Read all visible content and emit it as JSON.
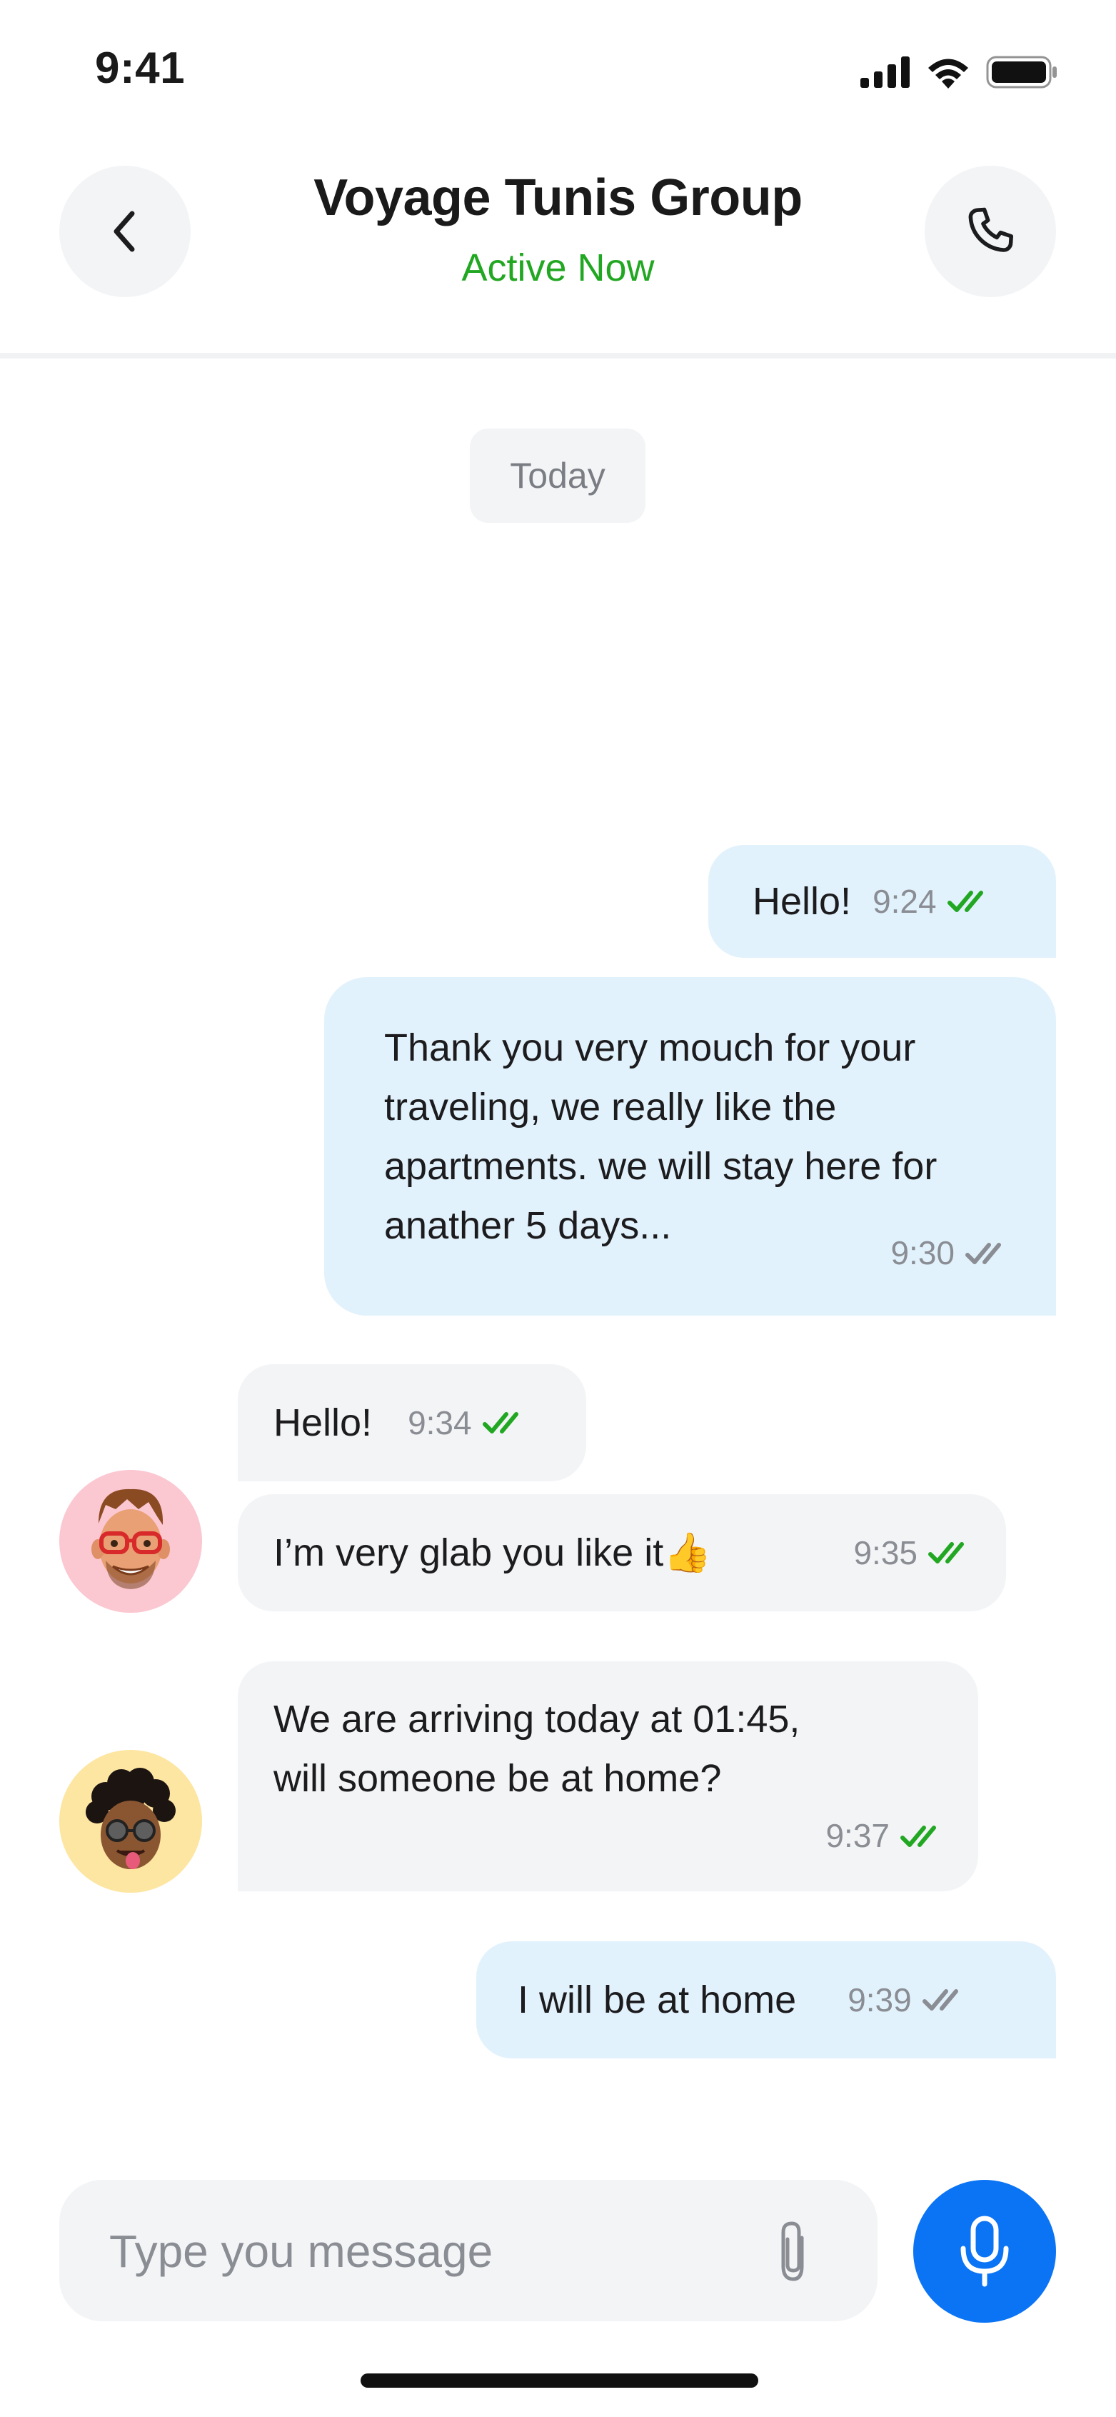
{
  "status_bar": {
    "time": "9:41",
    "icons": [
      "signal-icon",
      "wifi-icon",
      "battery-icon"
    ]
  },
  "header": {
    "title": "Voyage Tunis Group",
    "subtitle": "Active Now",
    "back_icon": "chevron-left-icon",
    "call_icon": "phone-icon",
    "active_color": "#22a722"
  },
  "date_separator": "Today",
  "messages": [
    {
      "id": "m1",
      "direction": "outgoing",
      "text": "Hello!",
      "time": "9:24",
      "status": "read"
    },
    {
      "id": "m2",
      "direction": "outgoing",
      "lines": [
        "Thank you very mouch for your",
        "traveling, we really like the",
        "apartments. we will stay here for",
        "anather 5 days..."
      ],
      "time": "9:30",
      "status": "delivered"
    },
    {
      "id": "m3",
      "direction": "incoming",
      "text": "Hello!",
      "time": "9:34",
      "status": "read"
    },
    {
      "id": "m4",
      "direction": "incoming",
      "text": "I’m very glab you like it👍",
      "time": "9:35",
      "status": "read"
    },
    {
      "id": "m5",
      "direction": "incoming",
      "lines": [
        "We are arriving today at 01:45,",
        "will someone be at home?"
      ],
      "time": "9:37",
      "status": "read"
    },
    {
      "id": "m6",
      "direction": "outgoing",
      "text": "I will be at home",
      "time": "9:39",
      "status": "delivered"
    }
  ],
  "avatars": [
    {
      "name": "memoji-glasses-avatar",
      "bg": "#fbc7d1"
    },
    {
      "name": "memoji-curly-avatar",
      "bg": "#fde5a2"
    }
  ],
  "composer": {
    "placeholder": "Type you message",
    "attach_icon": "paperclip-icon",
    "mic_icon": "microphone-icon"
  },
  "colors": {
    "outgoing_bubble": "#e2f2fc",
    "incoming_bubble": "#f3f4f6",
    "read_tick": "#22a722",
    "delivered_tick": "#8a8d93",
    "accent": "#0b74f5"
  }
}
